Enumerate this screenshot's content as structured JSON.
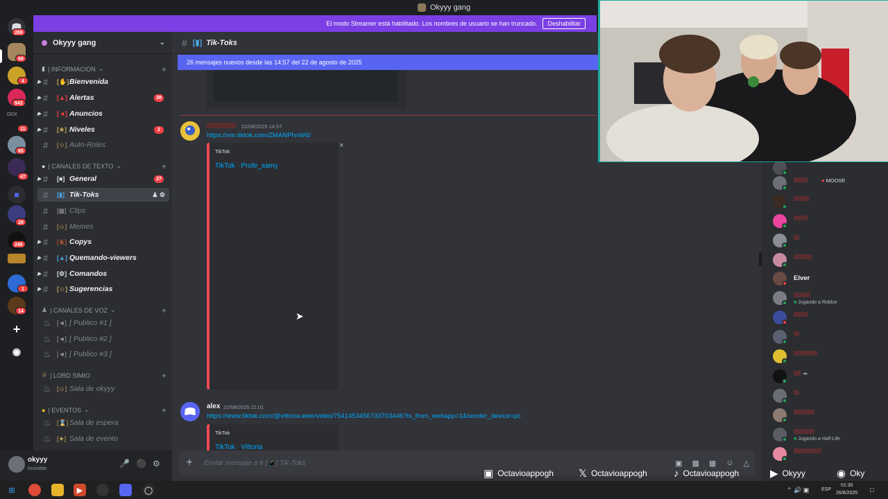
{
  "titlebar": {
    "server_name": "Okyyy gang"
  },
  "banner": {
    "text": "El modo Streamer está habilitado. Los nombres de usuario se han truncado.",
    "button": "Deshabilitar"
  },
  "rail": {
    "badges": [
      "289",
      "68",
      "4",
      "943",
      "11",
      "65",
      "47",
      "28",
      "248",
      "1",
      "14"
    ],
    "ddx_label": "DDX"
  },
  "sidebar": {
    "server_name": "Okyyy gang",
    "categories": {
      "informacion": "| INFORMACION",
      "canales_texto": "| CANALES DE TEXTO",
      "canales_voz": "| CANALES DE VOZ",
      "lord_simio": "| LORD SIMIO",
      "eventos": "| EVENTOS"
    },
    "channels": {
      "bienvenida": "Bienvenida",
      "alertas": "Alertas",
      "alertas_badge": "38",
      "anuncios": "Anuncios",
      "niveles": "Niveles",
      "niveles_badge": "2",
      "auto_roles": "Auto-Roles",
      "general": "General",
      "general_badge": "27",
      "tik_toks": "Tik-Toks",
      "clips": "Clips",
      "memes": "Memes",
      "copys": "Copys",
      "quemando": "Quemando-viewers",
      "comandos": "Comandos",
      "sugerencias": "Sugerencias",
      "publico1": "[ Publico #1 ]",
      "publico2": "[ Publico #2 ]",
      "publico3": "[ Publico #3 ]",
      "sala_okyyy": "Sala de okyyy",
      "sala_espera": "Sala de espera",
      "sala_evento": "Sala de evento"
    }
  },
  "user": {
    "name": "okyyy",
    "status": "Invisible"
  },
  "chat": {
    "channel": "Tik-Toks",
    "new_messages": "26 mensajes nuevos desde las 14:57 del 22 de agosto de 2025",
    "msg1": {
      "time": "22/08/2025 14:57",
      "link": "https://vm.tiktok.com/ZMANPhnW6/",
      "provider": "TikTok",
      "title": "TikTok · Profe_samy"
    },
    "msg2": {
      "author": "alex",
      "time": "22/08/2025 21:01",
      "link": "https://www.tiktok.com/@vittoria.elee/video/7541453456733703446?is_from_webapp=1&sender_device=pc",
      "provider": "TikTok",
      "title": "TikTok · Vittoria"
    },
    "composer_placeholder": "Enviar mensaje a # [📱] Tik-Toks"
  },
  "members": {
    "moose_tag": "MOOSE",
    "elver": "Elver",
    "activity_roblox": "Jugando a Roblox",
    "activity_halflife": "Jugando a Half-Life"
  },
  "overlay": {
    "instagram": "Octavioappogh",
    "x": "Octavioappogh",
    "tiktok": "Octavioappogh",
    "youtube": "Okyyy",
    "spotify": "Oky"
  },
  "taskbar": {
    "lang": "ESP",
    "time": "01:30",
    "date": "26/8/2025"
  },
  "colors": {
    "accent": "#5865f2",
    "streamer_banner": "#7b3fe4",
    "embed_border": "#ed4956",
    "badge": "#f23f43"
  }
}
